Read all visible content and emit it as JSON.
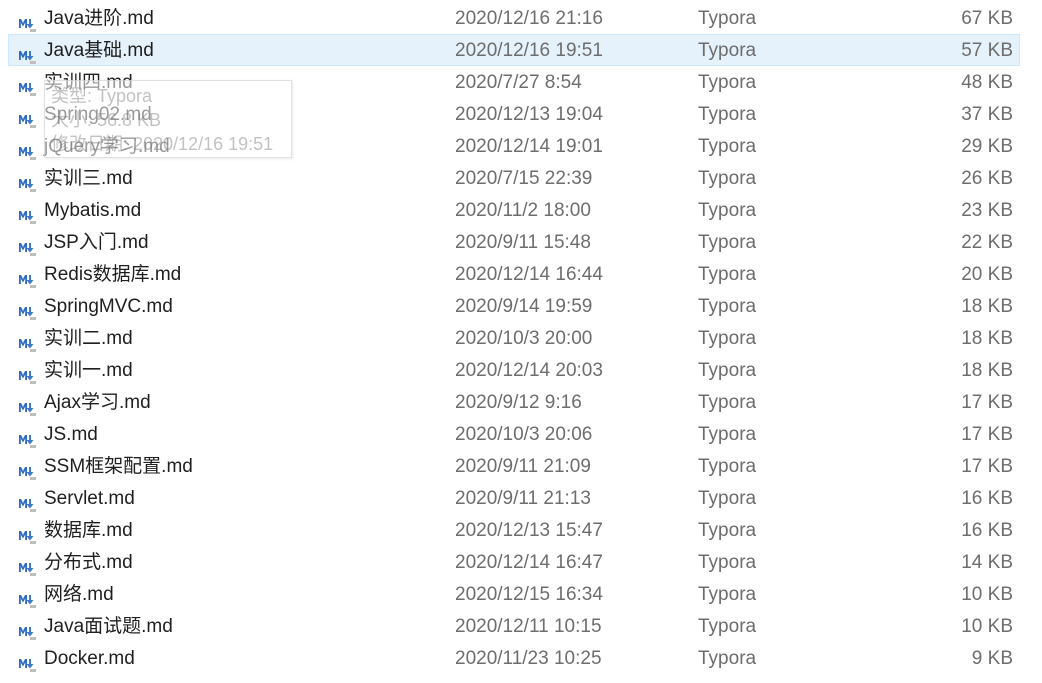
{
  "files": [
    {
      "name": "Java进阶.md",
      "date": "2020/12/16 21:16",
      "type": "Typora",
      "size": "67 KB",
      "selected": false
    },
    {
      "name": "Java基础.md",
      "date": "2020/12/16 19:51",
      "type": "Typora",
      "size": "57 KB",
      "selected": true
    },
    {
      "name": "实训四.md",
      "date": "2020/7/27 8:54",
      "type": "Typora",
      "size": "48 KB",
      "selected": false
    },
    {
      "name": "Spring02.md",
      "date": "2020/12/13 19:04",
      "type": "Typora",
      "size": "37 KB",
      "selected": false
    },
    {
      "name": "jQuery学习.md",
      "date": "2020/12/14 19:01",
      "type": "Typora",
      "size": "29 KB",
      "selected": false
    },
    {
      "name": "实训三.md",
      "date": "2020/7/15 22:39",
      "type": "Typora",
      "size": "26 KB",
      "selected": false
    },
    {
      "name": "Mybatis.md",
      "date": "2020/11/2 18:00",
      "type": "Typora",
      "size": "23 KB",
      "selected": false
    },
    {
      "name": "JSP入门.md",
      "date": "2020/9/11 15:48",
      "type": "Typora",
      "size": "22 KB",
      "selected": false
    },
    {
      "name": "Redis数据库.md",
      "date": "2020/12/14 16:44",
      "type": "Typora",
      "size": "20 KB",
      "selected": false
    },
    {
      "name": "SpringMVC.md",
      "date": "2020/9/14 19:59",
      "type": "Typora",
      "size": "18 KB",
      "selected": false
    },
    {
      "name": "实训二.md",
      "date": "2020/10/3 20:00",
      "type": "Typora",
      "size": "18 KB",
      "selected": false
    },
    {
      "name": "实训一.md",
      "date": "2020/12/14 20:03",
      "type": "Typora",
      "size": "18 KB",
      "selected": false
    },
    {
      "name": "Ajax学习.md",
      "date": "2020/9/12 9:16",
      "type": "Typora",
      "size": "17 KB",
      "selected": false
    },
    {
      "name": "JS.md",
      "date": "2020/10/3 20:06",
      "type": "Typora",
      "size": "17 KB",
      "selected": false
    },
    {
      "name": "SSM框架配置.md",
      "date": "2020/9/11 21:09",
      "type": "Typora",
      "size": "17 KB",
      "selected": false
    },
    {
      "name": "Servlet.md",
      "date": "2020/9/11 21:13",
      "type": "Typora",
      "size": "16 KB",
      "selected": false
    },
    {
      "name": "数据库.md",
      "date": "2020/12/13 15:47",
      "type": "Typora",
      "size": "16 KB",
      "selected": false
    },
    {
      "name": "分布式.md",
      "date": "2020/12/14 16:47",
      "type": "Typora",
      "size": "14 KB",
      "selected": false
    },
    {
      "name": "网络.md",
      "date": "2020/12/15 16:34",
      "type": "Typora",
      "size": "10 KB",
      "selected": false
    },
    {
      "name": "Java面试题.md",
      "date": "2020/12/11 10:15",
      "type": "Typora",
      "size": "10 KB",
      "selected": false
    },
    {
      "name": "Docker.md",
      "date": "2020/11/23 10:25",
      "type": "Typora",
      "size": "9 KB",
      "selected": false
    }
  ],
  "tooltip": {
    "line1": "类型: Typora",
    "line2": "大小: 56.8 KB",
    "line3": "修改日期: 2020/12/16 19:51"
  },
  "icon": "markdown-file-icon",
  "colors": {
    "selected_bg": "#e5f1fb",
    "selected_border": "#cce8ff",
    "icon_blue": "#2b6cc4"
  }
}
